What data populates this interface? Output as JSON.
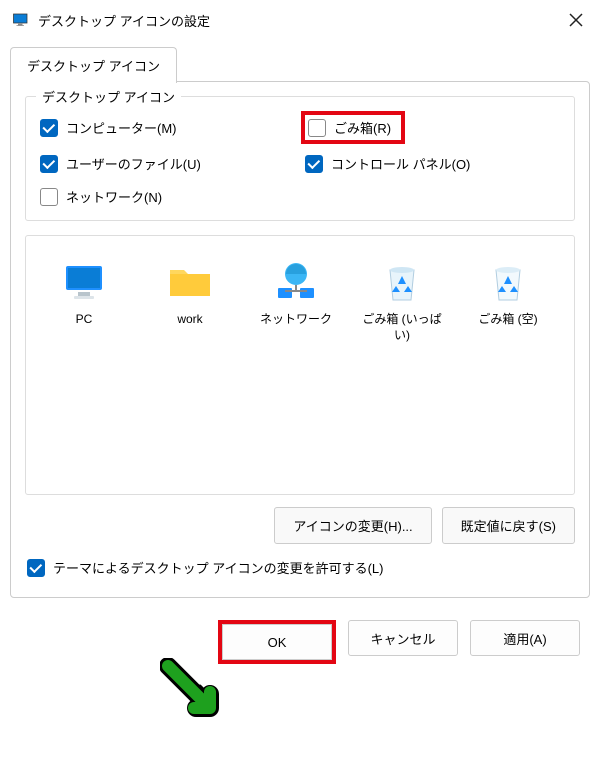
{
  "window": {
    "title": "デスクトップ アイコンの設定"
  },
  "tab": {
    "label": "デスクトップ アイコン"
  },
  "group": {
    "legend": "デスクトップ アイコン",
    "checkboxes": {
      "computer": {
        "label": "コンピューター(M)",
        "checked": true
      },
      "recycle": {
        "label": "ごみ箱(R)",
        "checked": false
      },
      "userfiles": {
        "label": "ユーザーのファイル(U)",
        "checked": true
      },
      "controlpanel": {
        "label": "コントロール パネル(O)",
        "checked": true
      },
      "network": {
        "label": "ネットワーク(N)",
        "checked": false
      }
    }
  },
  "icons": {
    "pc": "PC",
    "work": "work",
    "network": "ネットワーク",
    "recyclefull": "ごみ箱 (いっぱい)",
    "recycleempty": "ごみ箱 (空)"
  },
  "buttons": {
    "changeIcon": "アイコンの変更(H)...",
    "restoreDefault": "既定値に戻す(S)"
  },
  "allowThemes": {
    "label": "テーマによるデスクトップ アイコンの変更を許可する(L)",
    "checked": true
  },
  "dialogButtons": {
    "ok": "OK",
    "cancel": "キャンセル",
    "apply": "適用(A)"
  }
}
